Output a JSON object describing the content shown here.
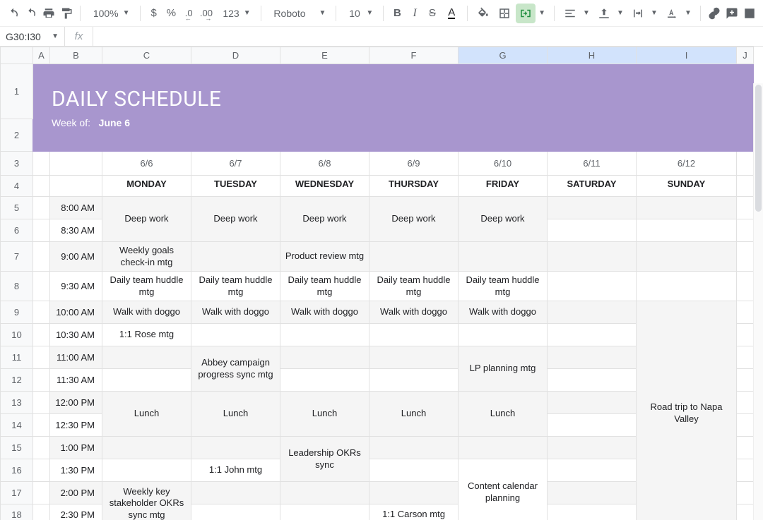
{
  "toolbar": {
    "zoom": "100%",
    "currency_glyph": "$",
    "percent_glyph": "%",
    "dec_dec": ".0",
    "dec_inc": ".00",
    "more_formats": "123",
    "font": "Roboto",
    "font_size": "10",
    "bold": "B",
    "italic": "I",
    "strike": "S",
    "textcolor": "A"
  },
  "namebox": "G30:I30",
  "fx_label": "fx",
  "columns": [
    "A",
    "B",
    "C",
    "D",
    "E",
    "F",
    "G",
    "H",
    "I",
    "J"
  ],
  "selected_columns": [
    "G",
    "H",
    "I"
  ],
  "rows": [
    "1",
    "2",
    "3",
    "4",
    "5",
    "6",
    "7",
    "8",
    "9",
    "10",
    "11",
    "12",
    "13",
    "14",
    "15",
    "16",
    "17",
    "18"
  ],
  "banner": {
    "title": "DAILY SCHEDULE",
    "weekof_label": "Week of:",
    "weekof_value": "June 6"
  },
  "dates": [
    "",
    "6/6",
    "6/7",
    "6/8",
    "6/9",
    "6/10",
    "6/11",
    "6/12"
  ],
  "days": [
    "",
    "MONDAY",
    "TUESDAY",
    "WEDNESDAY",
    "THURSDAY",
    "FRIDAY",
    "SATURDAY",
    "SUNDAY"
  ],
  "times": [
    "8:00 AM",
    "8:30 AM",
    "9:00 AM",
    "9:30 AM",
    "10:00 AM",
    "10:30 AM",
    "11:00 AM",
    "11:30 AM",
    "12:00 PM",
    "12:30 PM",
    "1:00 PM",
    "1:30 PM",
    "2:00 PM",
    "2:30 PM"
  ],
  "schedule": {
    "mon": {
      "deep": "Deep work",
      "goals": "Weekly goals check-in mtg",
      "huddle": "Daily team huddle mtg",
      "walk": "Walk with doggo",
      "rose": "1:1 Rose mtg",
      "lunch": "Lunch",
      "stakeholder": "Weekly key stakeholder OKRs sync mtg"
    },
    "tue": {
      "deep": "Deep work",
      "huddle": "Daily team huddle mtg",
      "walk": "Walk with doggo",
      "abbey": "Abbey campaign progress sync mtg",
      "lunch": "Lunch",
      "john": "1:1 John mtg"
    },
    "wed": {
      "deep": "Deep work",
      "product": "Product review mtg",
      "huddle": "Daily team huddle mtg",
      "walk": "Walk with doggo",
      "lunch": "Lunch",
      "okrs": "Leadership OKRs sync"
    },
    "thu": {
      "deep": "Deep work",
      "huddle": "Daily team huddle mtg",
      "walk": "Walk with doggo",
      "lunch": "Lunch",
      "carson": "1:1 Carson mtg"
    },
    "fri": {
      "deep": "Deep work",
      "huddle": "Daily team huddle mtg",
      "walk": "Walk with doggo",
      "lp": "LP planning mtg",
      "lunch": "Lunch",
      "content": "Content calendar planning"
    },
    "sun": {
      "napa": "Road trip to Napa Valley"
    }
  }
}
